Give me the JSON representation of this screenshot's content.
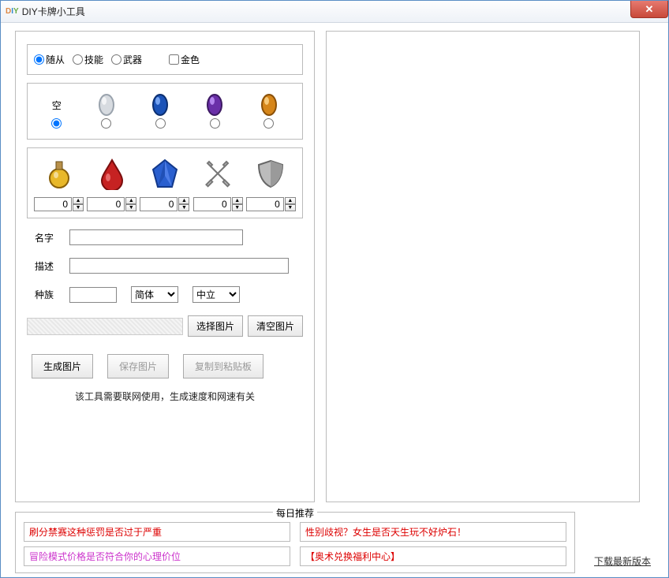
{
  "window": {
    "title": "DIY卡牌小工具"
  },
  "cardType": {
    "options": [
      "随从",
      "技能",
      "武器"
    ],
    "selected": 0,
    "golden_label": "金色",
    "golden_checked": false
  },
  "gems": {
    "empty_label": "空",
    "selected": 0,
    "items": [
      {
        "name": "empty"
      },
      {
        "name": "silver",
        "fill": "#d7dbe0",
        "stroke": "#9aa3ad"
      },
      {
        "name": "blue",
        "fill": "#1b53b8",
        "stroke": "#0c2f70"
      },
      {
        "name": "purple",
        "fill": "#6a2fa8",
        "stroke": "#3d1a63"
      },
      {
        "name": "orange",
        "fill": "#d6861a",
        "stroke": "#8a5008"
      }
    ]
  },
  "stats": {
    "icons": [
      "mana-potion",
      "blood-drop",
      "crystal",
      "swords",
      "shield"
    ],
    "values": [
      "0",
      "0",
      "0",
      "0",
      "0"
    ]
  },
  "form": {
    "name_label": "名字",
    "name_value": "",
    "desc_label": "描述",
    "desc_value": "",
    "race_label": "种族",
    "race_value": "",
    "script_options": [
      "简体"
    ],
    "script_value": "简体",
    "faction_options": [
      "中立"
    ],
    "faction_value": "中立"
  },
  "image": {
    "select_label": "选择图片",
    "clear_label": "清空图片"
  },
  "actions": {
    "generate": "生成图片",
    "save": "保存图片",
    "copy": "复制到粘贴板"
  },
  "note": "该工具需要联网使用，生成速度和网速有关",
  "recommend": {
    "title": "每日推荐",
    "items": [
      {
        "text": "刷分禁赛这种惩罚是否过于严重",
        "color": "red"
      },
      {
        "text": "性别歧视？女生是否天生玩不好炉石！",
        "color": "red"
      },
      {
        "text": "冒险模式价格是否符合你的心理价位",
        "color": "magenta"
      },
      {
        "text": "【奥术兑换福利中心】",
        "color": "red"
      }
    ]
  },
  "download": "下载最新版本"
}
